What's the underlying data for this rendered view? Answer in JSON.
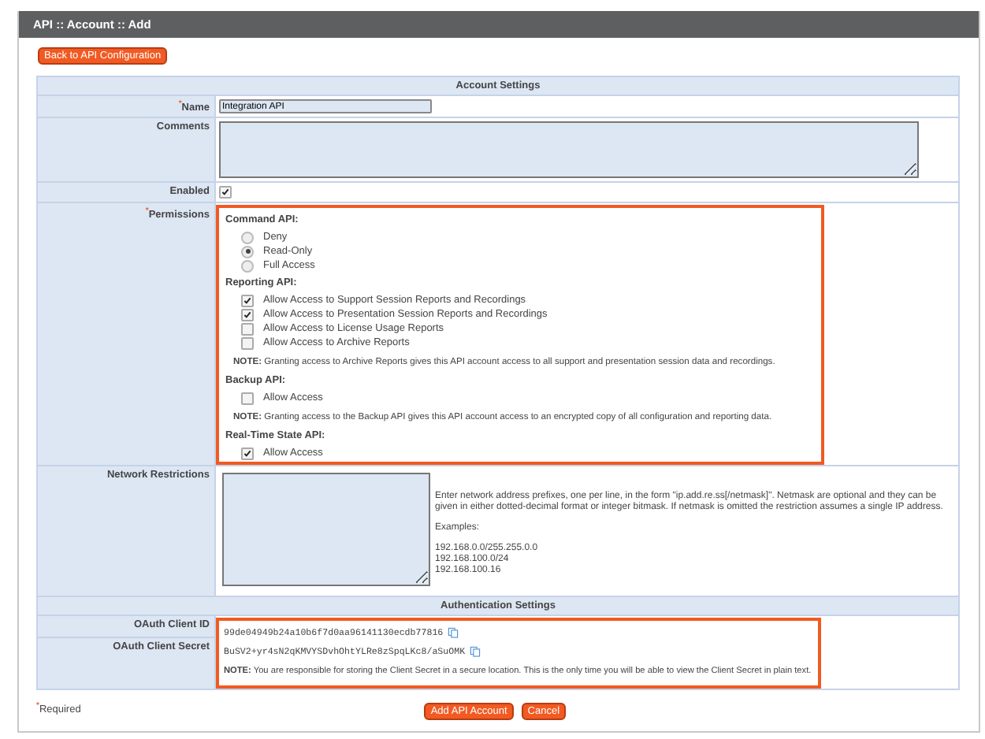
{
  "window": {
    "title": "API :: Account :: Add"
  },
  "back_button": "Back to API Configuration",
  "account_settings": {
    "heading": "Account Settings",
    "name": {
      "label": "Name",
      "required": true,
      "value": "Integration API"
    },
    "comments": {
      "label": "Comments"
    },
    "enabled": {
      "label": "Enabled",
      "checked": true
    },
    "permissions": {
      "label": "Permissions",
      "required": true,
      "highlighted": true,
      "groups": [
        {
          "title": "Command API:",
          "kind": "radio",
          "options": [
            {
              "label": "Deny",
              "selected": false
            },
            {
              "label": "Read-Only",
              "selected": true
            },
            {
              "label": "Full Access",
              "selected": false
            }
          ]
        },
        {
          "title": "Reporting API:",
          "kind": "checkbox",
          "options": [
            {
              "label": "Allow Access to Support Session Reports and Recordings",
              "checked": true
            },
            {
              "label": "Allow Access to Presentation Session Reports and Recordings",
              "checked": true
            },
            {
              "label": "Allow Access to License Usage Reports",
              "checked": false
            },
            {
              "label": "Allow Access to Archive Reports",
              "checked": false
            }
          ],
          "note": "**NOTE:** Granting access to Archive Reports gives this API account access to all support and presentation session data and recordings."
        },
        {
          "title": "Backup API:",
          "kind": "checkbox",
          "options": [
            {
              "label": "Allow Access",
              "checked": false
            }
          ],
          "note": "**NOTE:** Granting access to the Backup API gives this API account access to an encrypted copy of all configuration and reporting data."
        },
        {
          "title": "Real-Time State API:",
          "kind": "checkbox",
          "options": [
            {
              "label": "Allow Access",
              "checked": true
            }
          ]
        }
      ]
    },
    "network": {
      "label": "Network Restrictions",
      "help": "Enter network address prefixes, one per line, in the form \"ip.add.re.ss[/netmask]\". Netmask are optional and they can be given in either dotted-decimal format or integer bitmask. If netmask is omitted the restriction assumes a single IP address.",
      "examples_label": "Examples:",
      "examples": [
        "192.168.0.0/255.255.0.0",
        "192.168.100.0/24",
        "192.168.100.16"
      ]
    }
  },
  "authentication_settings": {
    "heading": "Authentication Settings",
    "highlighted": true,
    "client_id": {
      "label": "OAuth Client ID",
      "value": "99de04949b24a10b6f7d0aa96141130ecdb77816"
    },
    "client_secret": {
      "label": "OAuth Client Secret",
      "value": "BuSV2+yr4sN2qKMVYSDvhOhtYLRe8zSpqLKc8/aSuOMK",
      "note": "**NOTE:** You are responsible for storing the Client Secret in a secure location. This is the only time you will be able to view the Client Secret in plain text."
    }
  },
  "required_mark": "*",
  "required_note": "Required",
  "buttons": [
    "Add API Account",
    "Cancel"
  ]
}
